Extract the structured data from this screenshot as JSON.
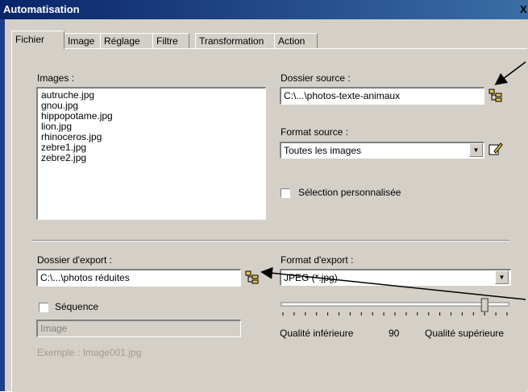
{
  "window": {
    "title": "Automatisation",
    "close_glyph": "X"
  },
  "tabs": [
    {
      "label": "Fichier",
      "active": true
    },
    {
      "label": "Image"
    },
    {
      "label": "Réglage"
    },
    {
      "label": "Filtre"
    },
    {
      "label": "Transformation"
    },
    {
      "label": "Action"
    }
  ],
  "images": {
    "label": "Images :",
    "items": [
      "autruche.jpg",
      "gnou.jpg",
      "hippopotame.jpg",
      "lion.jpg",
      "rhinoceros.jpg",
      "zebre1.jpg",
      "zebre2.jpg"
    ]
  },
  "source": {
    "folder_label": "Dossier source :",
    "folder_value": "C:\\...\\photos-texte-animaux",
    "format_label": "Format source :",
    "format_value": "Toutes les images",
    "custom_selection_label": "Sélection personnalisée"
  },
  "export": {
    "folder_label": "Dossier d'export :",
    "folder_value": "C:\\...\\photos réduites",
    "format_label": "Format d'export :",
    "format_value": "JPEG (*.jpg)",
    "sequence_label": "Séquence",
    "sequence_value": "Image",
    "example_text": "Exemple : Image001.jpg"
  },
  "quality": {
    "low_label": "Qualité inférieure",
    "value": "90",
    "high_label": "Qualité supérieure",
    "level": 90
  },
  "icons": {
    "folder": "folder-tree-icon",
    "edit": "edit-pencil-icon",
    "dropdown": "chevron-down-icon"
  }
}
